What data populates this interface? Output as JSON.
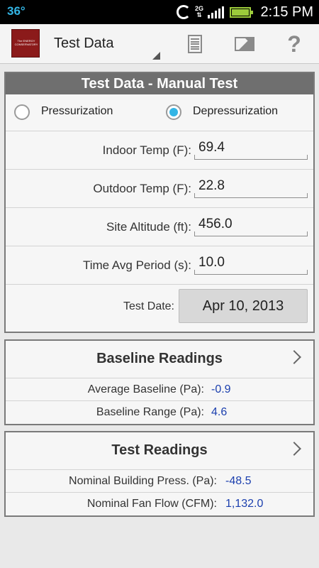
{
  "status_bar": {
    "temperature": "36°",
    "network": "2G",
    "time": "2:15 PM"
  },
  "action_bar": {
    "title": "Test Data",
    "logo_text": "The ENERGY CONSERVATORY",
    "icons": [
      "document-icon",
      "mail-icon",
      "help-icon"
    ],
    "help_glyph": "?"
  },
  "manual_test": {
    "header": "Test Data - Manual Test",
    "mode_options": [
      {
        "label": "Pressurization",
        "selected": false
      },
      {
        "label": "Depressurization",
        "selected": true
      }
    ],
    "fields": [
      {
        "label": "Indoor Temp (F):",
        "value": "69.4"
      },
      {
        "label": "Outdoor Temp (F):",
        "value": "22.8"
      },
      {
        "label": "Site Altitude (ft):",
        "value": "456.0"
      },
      {
        "label": "Time Avg Period (s):",
        "value": "10.0"
      }
    ],
    "test_date_label": "Test Date:",
    "test_date_value": "Apr 10, 2013"
  },
  "baseline": {
    "title": "Baseline Readings",
    "rows": [
      {
        "label": "Average Baseline (Pa):",
        "value": "-0.9"
      },
      {
        "label": "Baseline Range (Pa):",
        "value": "4.6"
      }
    ]
  },
  "test_readings": {
    "title": "Test Readings",
    "rows": [
      {
        "label": "Nominal Building Press. (Pa):",
        "value": "-48.5"
      },
      {
        "label": "Nominal Fan Flow (CFM):",
        "value": "1,132.0"
      }
    ]
  },
  "colors": {
    "accent": "#33b5e5",
    "value_text": "#1b3fae",
    "panel_header": "#6f6f6f"
  }
}
